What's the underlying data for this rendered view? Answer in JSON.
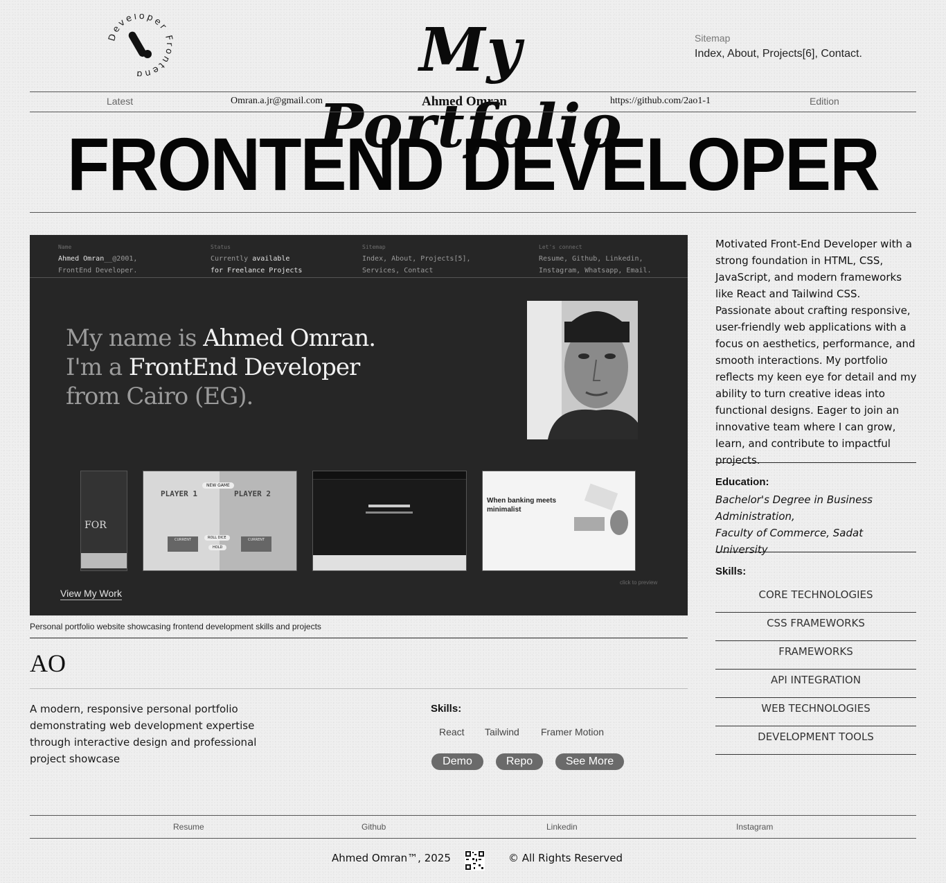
{
  "header": {
    "logo_text": "Developer Frontend",
    "title": "My Portfolio",
    "sitemap_label": "Sitemap",
    "sitemap_links": "Index, About, Projects[6], Contact."
  },
  "meta_bar": {
    "latest": "Latest",
    "email": "Omran.a.jr@gmail.com",
    "name": "Ahmed Omran",
    "github": "https://github.com/2ao1-1",
    "edition": "Edition"
  },
  "headline": "FRONTEND DEVELOPER",
  "hero_preview": {
    "columns": [
      {
        "label": "Name",
        "line1_hi": "Ahmed Omran",
        "line1_rest": "__@2001,",
        "line2": "FrontEnd Developer."
      },
      {
        "label": "Status",
        "line1_pre": "Currently ",
        "line1_hi": "available",
        "line2": "for Freelance Projects"
      },
      {
        "label": "Sitemap",
        "line1": "Index, About, Projects[5],",
        "line2": "Services, Contact"
      },
      {
        "label": "Let's connect",
        "line1": "Resume, Github, Linkedin,",
        "line2": "Instagram, Whatsapp, Email."
      }
    ],
    "intro_a": "My name is ",
    "intro_b": "Ahmed Omran.",
    "intro_c": "I'm a ",
    "intro_d": "FrontEnd Developer",
    "intro_e": "from Cairo (EG).",
    "view_work": "View My Work",
    "click_preview": "click to preview",
    "thumb_for": "FOR",
    "thumb_game_new": "NEW GAME",
    "thumb_game_p1": "PLAYER 1",
    "thumb_game_p2": "PLAYER 2",
    "thumb_game_current": "CURRENT",
    "thumb_game_roll": "ROLL DICE",
    "thumb_game_hold": "HOLD",
    "thumb_bank_title": "When banking meets minimalist"
  },
  "caption": "Personal portfolio website showcasing frontend development skills and projects",
  "project": {
    "logo": "AO",
    "description": "A modern, responsive personal portfolio demonstrating web development expertise through interactive design and professional project showcase",
    "skills_label": "Skills:",
    "tags": [
      "React",
      "Tailwind",
      "Framer Motion"
    ],
    "buttons": {
      "demo": "Demo",
      "repo": "Repo",
      "more": "See More"
    }
  },
  "about": {
    "bio": "Motivated Front-End Developer with a strong foundation in HTML, CSS, JavaScript, and modern frameworks like React and Tailwind CSS. Passionate about crafting responsive, user-friendly web applications with a focus on aesthetics, performance, and smooth interactions. My portfolio reflects my keen eye for detail and my ability to turn creative ideas into functional designs. Eager to join an innovative team where I can grow, learn, and contribute to impactful projects.",
    "education_title": "Education:",
    "education_line1": "Bachelor's Degree in Business Administration,",
    "education_line2": "Faculty of Commerce, Sadat University",
    "skills_title": "Skills:",
    "skills": [
      "CORE TECHNOLOGIES",
      "CSS FRAMEWORKS",
      "FRAMEWORKS",
      "API INTEGRATION",
      "WEB TECHNOLOGIES",
      "DEVELOPMENT TOOLS"
    ]
  },
  "footer": {
    "links": [
      "Resume",
      "Github",
      "Linkedin",
      "Instagram"
    ],
    "copyright_left": "Ahmed Omran™, 2025",
    "copyright_right": "© All Rights Reserved"
  }
}
